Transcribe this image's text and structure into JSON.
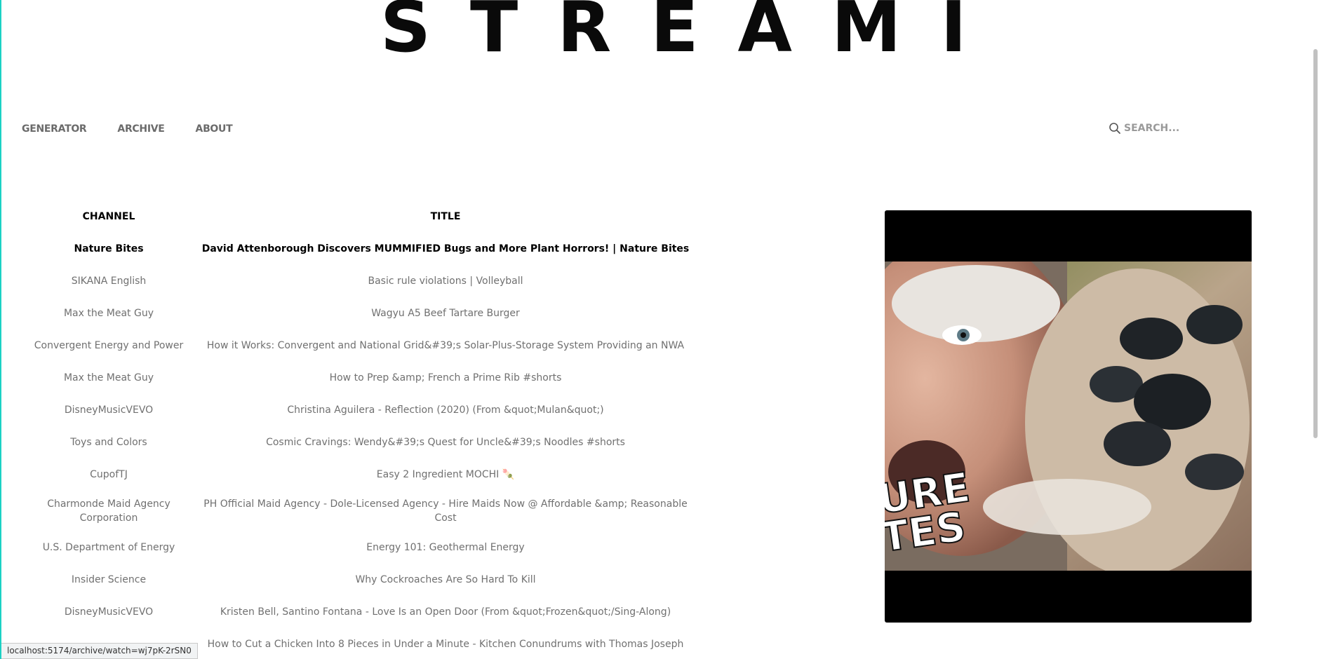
{
  "brand": {
    "logo": "STREAMI"
  },
  "nav": {
    "items": [
      {
        "label": "GENERATOR"
      },
      {
        "label": "ARCHIVE"
      },
      {
        "label": "ABOUT"
      }
    ]
  },
  "search": {
    "placeholder": "SEARCH..."
  },
  "table": {
    "headers": {
      "channel": "CHANNEL",
      "title": "TITLE"
    },
    "rows": [
      {
        "channel": "Nature Bites",
        "title": "David Attenborough Discovers MUMMIFIED Bugs and More Plant Horrors! | Nature Bites"
      },
      {
        "channel": "SIKANA English",
        "title": "Basic rule violations | Volleyball"
      },
      {
        "channel": "Max the Meat Guy",
        "title": "Wagyu A5 Beef Tartare Burger"
      },
      {
        "channel": "Convergent Energy and Power",
        "title": "How it Works: Convergent and National Grid&#39;s Solar-Plus-Storage System Providing an NWA"
      },
      {
        "channel": "Max the Meat Guy",
        "title": "How to Prep &amp; French a Prime Rib #shorts"
      },
      {
        "channel": "DisneyMusicVEVO",
        "title": "Christina Aguilera - Reflection (2020) (From &quot;Mulan&quot;)"
      },
      {
        "channel": "Toys and Colors",
        "title": "Cosmic Cravings: Wendy&#39;s Quest for Uncle&#39;s Noodles #shorts"
      },
      {
        "channel": "CupofTJ",
        "title": "Easy 2 Ingredient MOCHI 🍡"
      },
      {
        "channel": "Charmonde Maid Agency Corporation",
        "title": "PH Official Maid Agency - Dole-Licensed Agency - Hire Maids Now @ Affordable &amp; Reasonable Cost"
      },
      {
        "channel": "U.S. Department of Energy",
        "title": "Energy 101: Geothermal Energy"
      },
      {
        "channel": "Insider Science",
        "title": "Why Cockroaches Are So Hard To Kill"
      },
      {
        "channel": "DisneyMusicVEVO",
        "title": "Kristen Bell, Santino Fontana - Love Is an Open Door (From &quot;Frozen&quot;/Sing-Along)"
      },
      {
        "channel": "",
        "title": "How to Cut a Chicken Into 8 Pieces in Under a Minute - Kitchen Conundrums with Thomas Joseph"
      }
    ]
  },
  "player": {
    "thumbnail_text": "URE\nTES"
  },
  "status_bar": {
    "url": "localhost:5174/archive/watch=wj7pK-2rSN0"
  },
  "colors": {
    "accent_border": "#1bd1c4",
    "text_muted": "#707070",
    "text_strong": "#000000"
  }
}
